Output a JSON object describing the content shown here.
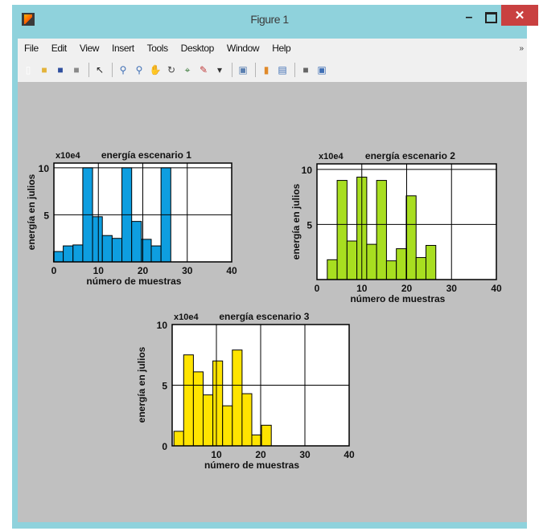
{
  "window": {
    "title": "Figure 1",
    "min_label": "–",
    "close_label": "✕"
  },
  "menu": [
    "File",
    "Edit",
    "View",
    "Insert",
    "Tools",
    "Desktop",
    "Window",
    "Help"
  ],
  "menu_more_label": "»",
  "toolbar_icons": [
    {
      "name": "new-figure-icon",
      "glyph": "▯",
      "color": "#ffffff"
    },
    {
      "name": "open-file-icon",
      "glyph": "■",
      "color": "#e3b33a"
    },
    {
      "name": "save-icon",
      "glyph": "■",
      "color": "#2f4f9e"
    },
    {
      "name": "print-icon",
      "glyph": "■",
      "color": "#8a8a8a"
    },
    {
      "name": "sep"
    },
    {
      "name": "edit-plot-icon",
      "glyph": "↖",
      "color": "#222222"
    },
    {
      "name": "sep"
    },
    {
      "name": "zoom-in-icon",
      "glyph": "⚲",
      "color": "#3f6fb5"
    },
    {
      "name": "zoom-out-icon",
      "glyph": "⚲",
      "color": "#3f6fb5"
    },
    {
      "name": "pan-icon",
      "glyph": "✋",
      "color": "#b98a3c"
    },
    {
      "name": "rotate-3d-icon",
      "glyph": "↻",
      "color": "#444444"
    },
    {
      "name": "data-cursor-icon",
      "glyph": "⌖",
      "color": "#3a7a3a"
    },
    {
      "name": "brush-icon",
      "glyph": "✎",
      "color": "#c03a3a"
    },
    {
      "name": "brush-menu-icon",
      "glyph": "▾",
      "color": "#333333"
    },
    {
      "name": "sep"
    },
    {
      "name": "link-plot-icon",
      "glyph": "▣",
      "color": "#5a7fb0"
    },
    {
      "name": "sep"
    },
    {
      "name": "colorbar-icon",
      "glyph": "▮",
      "color": "#e08a2a"
    },
    {
      "name": "legend-icon",
      "glyph": "▤",
      "color": "#3f6fb5"
    },
    {
      "name": "sep"
    },
    {
      "name": "hide-tools-icon",
      "glyph": "■",
      "color": "#666666"
    },
    {
      "name": "show-tools-icon",
      "glyph": "▣",
      "color": "#3f6fb5"
    }
  ],
  "chart_data": [
    {
      "type": "bar",
      "title": "energía escenario 1",
      "exponent_label": "x10e4",
      "xlabel": "número de muestras",
      "ylabel": "energía en julios",
      "xlim": [
        0,
        40
      ],
      "ylim": [
        0,
        10.5
      ],
      "xticks": [
        0,
        10,
        20,
        30,
        40
      ],
      "yticks": [
        5,
        10
      ],
      "bar_color": "#0e9ee0",
      "bin_width": 2.2,
      "x": [
        1,
        3.2,
        5.4,
        7.6,
        9.8,
        12,
        14.2,
        16.4,
        18.6,
        20.8,
        23,
        25.2,
        27.4,
        29.6
      ],
      "values": [
        1.1,
        1.7,
        1.8,
        10,
        4.8,
        2.8,
        2.5,
        10,
        4.3,
        2.4,
        1.7,
        10,
        0,
        0
      ]
    },
    {
      "type": "bar",
      "title": "energía escenario 2",
      "exponent_label": "x10e4",
      "xlabel": "número de muestras",
      "ylabel": "energía en julios",
      "xlim": [
        0,
        40
      ],
      "ylim": [
        0,
        10.5
      ],
      "xticks": [
        0,
        10,
        20,
        30,
        40
      ],
      "yticks": [
        5,
        10
      ],
      "bar_color": "#a8de20",
      "bin_width": 2.2,
      "x": [
        3.4,
        5.6,
        7.8,
        10,
        12.2,
        14.4,
        16.6,
        18.8,
        21,
        23.2,
        25.4,
        27.6
      ],
      "values": [
        1.8,
        9,
        3.5,
        9.3,
        3.2,
        9,
        1.7,
        2.8,
        7.6,
        2,
        3.1,
        0
      ]
    },
    {
      "type": "bar",
      "title": "energía escenario 3",
      "exponent_label": "x10e4",
      "xlabel": "número de muestras",
      "ylabel": "energía en julios",
      "xlim": [
        0,
        40
      ],
      "ylim": [
        0,
        10
      ],
      "xticks": [
        10,
        20,
        30,
        40
      ],
      "yticks": [
        0,
        5,
        10
      ],
      "bar_color": "#ffe400",
      "bin_width": 2.2,
      "x": [
        1.5,
        3.7,
        5.9,
        8.1,
        10.3,
        12.5,
        14.7,
        16.9,
        19.1,
        21.3,
        23.5,
        25.7
      ],
      "values": [
        1.2,
        7.5,
        6.1,
        4.2,
        7,
        3.3,
        7.9,
        4.3,
        0.9,
        1.7,
        0,
        0
      ]
    }
  ]
}
